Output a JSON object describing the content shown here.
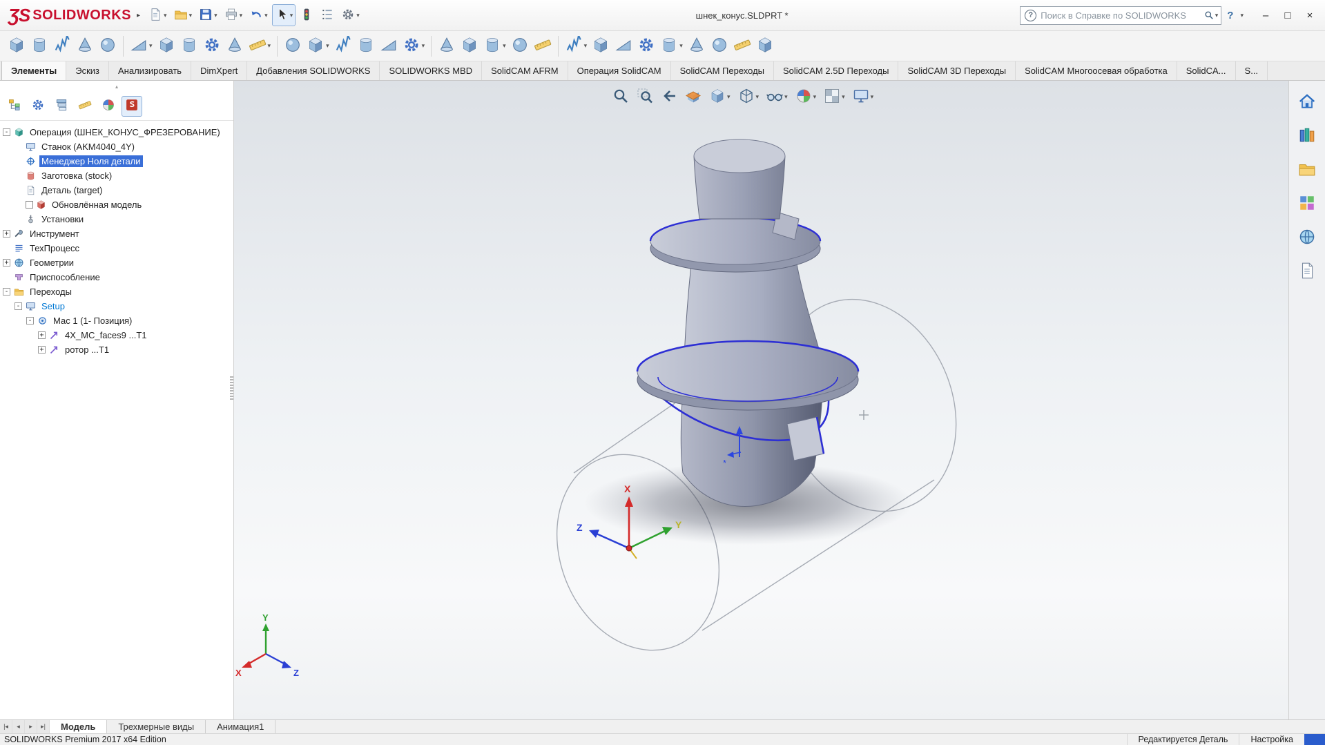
{
  "colors": {
    "logo_red": "#c8102e",
    "selection_blue": "#3a6fd8",
    "edge_highlight_blue": "#2d2fd4",
    "accent_text_blue": "#0078d4",
    "status_corner_blue": "#2a5ccc"
  },
  "titlebar": {
    "logo_mark": "ƷS",
    "logo_text": "SOLIDWORKS",
    "document_title": "шнек_конус.SLDPRT *",
    "search_placeholder": "Поиск в Справке по SOLIDWORKS",
    "help_label": "?",
    "quick_access": [
      {
        "name": "new-document-icon",
        "type": "page",
        "caret": true
      },
      {
        "name": "open-icon",
        "type": "folder",
        "caret": true
      },
      {
        "name": "save-icon",
        "type": "save",
        "caret": true
      },
      {
        "name": "print-icon",
        "type": "print",
        "caret": true
      },
      {
        "name": "undo-icon",
        "type": "undo",
        "caret": true
      },
      {
        "name": "select-icon",
        "type": "cursor",
        "caret": true,
        "pressed": true
      },
      {
        "name": "rebuild-icon",
        "type": "traffic"
      },
      {
        "name": "file-properties-icon",
        "type": "list"
      },
      {
        "name": "options-icon",
        "type": "gear",
        "caret": true
      }
    ],
    "window_buttons": [
      {
        "name": "minimize-button",
        "glyph": "–"
      },
      {
        "name": "maximize-button",
        "glyph": "□"
      },
      {
        "name": "close-button",
        "glyph": "×"
      }
    ]
  },
  "cam_toolbar": {
    "items": [
      {
        "type": "cube"
      },
      {
        "type": "cylb"
      },
      {
        "type": "spring"
      },
      {
        "type": "cone"
      },
      {
        "type": "sphereb"
      },
      {
        "sep": true
      },
      {
        "type": "wedge",
        "caret": true
      },
      {
        "type": "cube"
      },
      {
        "type": "cylb"
      },
      {
        "type": "gearb"
      },
      {
        "type": "cone"
      },
      {
        "type": "ruler",
        "caret": true
      },
      {
        "sep": true
      },
      {
        "type": "sphereb"
      },
      {
        "type": "cube",
        "caret": true
      },
      {
        "type": "spring"
      },
      {
        "type": "cylb"
      },
      {
        "type": "wedge"
      },
      {
        "type": "gearb",
        "caret": true
      },
      {
        "sep": true
      },
      {
        "type": "cone"
      },
      {
        "type": "cube"
      },
      {
        "type": "cylb",
        "caret": true
      },
      {
        "type": "sphereb"
      },
      {
        "type": "ruler"
      },
      {
        "sep": true
      },
      {
        "type": "spring",
        "caret": true
      },
      {
        "type": "cube"
      },
      {
        "type": "wedge"
      },
      {
        "type": "gearb"
      },
      {
        "type": "cylb",
        "caret": true
      },
      {
        "type": "cone"
      },
      {
        "type": "sphereb"
      },
      {
        "type": "ruler"
      },
      {
        "type": "cube"
      }
    ]
  },
  "command_tabs": [
    {
      "label": "Элементы",
      "active": true
    },
    {
      "label": "Эскиз"
    },
    {
      "label": "Анализировать"
    },
    {
      "label": "DimXpert"
    },
    {
      "label": "Добавления SOLIDWORKS"
    },
    {
      "label": "SOLIDWORKS MBD"
    },
    {
      "label": "SolidCAM AFRM"
    },
    {
      "label": "Операция SolidCAM"
    },
    {
      "label": "SolidCAM Переходы"
    },
    {
      "label": "SolidCAM 2.5D Переходы"
    },
    {
      "label": "SolidCAM 3D Переходы"
    },
    {
      "label": "SolidCAM Многоосевая обработка"
    },
    {
      "label": "SolidCA..."
    },
    {
      "label": "S..."
    }
  ],
  "feature_panel": {
    "tabs": [
      {
        "name": "featuremanager-tab",
        "type": "tree"
      },
      {
        "name": "propertymanager-tab",
        "type": "gearb"
      },
      {
        "name": "configurationmanager-tab",
        "type": "layers"
      },
      {
        "name": "dimxpertmanager-tab",
        "type": "ruler"
      },
      {
        "name": "displaymanager-tab",
        "type": "sphere-color"
      },
      {
        "name": "solidcam-manager-tab",
        "type": "scam",
        "active": true
      }
    ],
    "tree": [
      {
        "name": "operation",
        "label": "Операция (ШНЕК_КОНУС_ФРЕЗЕРОВАНИЕ)",
        "indent": 0,
        "exp": "minus",
        "type": "tealcube"
      },
      {
        "name": "machine",
        "label": "Станок (AKM4040_4Y)",
        "indent": 1,
        "type": "monitor"
      },
      {
        "name": "zero-manager",
        "label": "Менеджер Ноля детали",
        "indent": 1,
        "type": "crosshair",
        "selected": true
      },
      {
        "name": "stock",
        "label": "Заготовка (stock)",
        "indent": 1,
        "type": "redcyl"
      },
      {
        "name": "target",
        "label": "Деталь (target)",
        "indent": 1,
        "type": "page"
      },
      {
        "name": "updated-model",
        "label": "Обновлённая модель",
        "indent": 1,
        "type": "redcube",
        "checkbox": true
      },
      {
        "name": "setups",
        "label": "Установки",
        "indent": 1,
        "type": "pin"
      },
      {
        "name": "tool",
        "label": "Инструмент",
        "indent": 0,
        "exp": "plus",
        "type": "wrench"
      },
      {
        "name": "process",
        "label": "ТехПроцесс",
        "indent": 0,
        "type": "listb"
      },
      {
        "name": "geometries",
        "label": "Геометрии",
        "indent": 0,
        "exp": "plus",
        "type": "globe"
      },
      {
        "name": "fixture",
        "label": "Приспособление",
        "indent": 0,
        "type": "clamp"
      },
      {
        "name": "operations",
        "label": "Переходы",
        "indent": 0,
        "exp": "minus",
        "type": "folder"
      },
      {
        "name": "setup",
        "label": "Setup",
        "indent": 1,
        "exp": "minus",
        "type": "monitor",
        "accent": true
      },
      {
        "name": "mac-position",
        "label": "Мас 1 (1- Позиция)",
        "indent": 2,
        "exp": "minus",
        "type": "pos"
      },
      {
        "name": "op-4x-mc-faces9",
        "label": "4X_MC_faces9 ...T1",
        "indent": 3,
        "exp": "plus",
        "type": "oparrow"
      },
      {
        "name": "op-rotor",
        "label": "ротор ...T1",
        "indent": 3,
        "exp": "plus",
        "type": "oparrow"
      }
    ]
  },
  "viewport": {
    "hud": [
      {
        "name": "zoom-fit-icon",
        "type": "zoom"
      },
      {
        "name": "zoom-area-icon",
        "type": "zoom-area"
      },
      {
        "name": "previous-view-icon",
        "type": "prev"
      },
      {
        "name": "section-view-icon",
        "type": "section"
      },
      {
        "name": "view-orientation-icon",
        "type": "cubeb",
        "caret": true
      },
      {
        "name": "display-style-icon",
        "type": "cube-wire",
        "caret": true
      },
      {
        "name": "hide-show-items-icon",
        "type": "glasses",
        "caret": true
      },
      {
        "name": "edit-appearance-icon",
        "type": "sphere-color",
        "caret": true
      },
      {
        "name": "apply-scene-icon",
        "type": "scene",
        "caret": true
      },
      {
        "name": "view-settings-icon",
        "type": "monitor",
        "caret": true
      }
    ],
    "triad": {
      "x": "X",
      "y": "Y",
      "z": "Z"
    }
  },
  "task_pane": [
    {
      "name": "solidworks-resources-icon",
      "type": "home"
    },
    {
      "name": "design-library-icon",
      "type": "library"
    },
    {
      "name": "file-explorer-icon",
      "type": "folder"
    },
    {
      "name": "view-palette-icon",
      "type": "palette"
    },
    {
      "name": "appearances-scenes-icon",
      "type": "globe"
    },
    {
      "name": "custom-properties-icon",
      "type": "page"
    }
  ],
  "bottom_bar": {
    "nav": [
      "|◂",
      "◂",
      "▸",
      "▸|"
    ],
    "tabs": [
      {
        "label": "Модель",
        "active": true
      },
      {
        "label": "Трехмерные виды"
      },
      {
        "label": "Анимация1"
      }
    ]
  },
  "statusbar": {
    "left": "SOLIDWORKS Premium 2017 x64 Edition",
    "edit_mode": "Редактируется Деталь",
    "customize": "Настройка"
  }
}
